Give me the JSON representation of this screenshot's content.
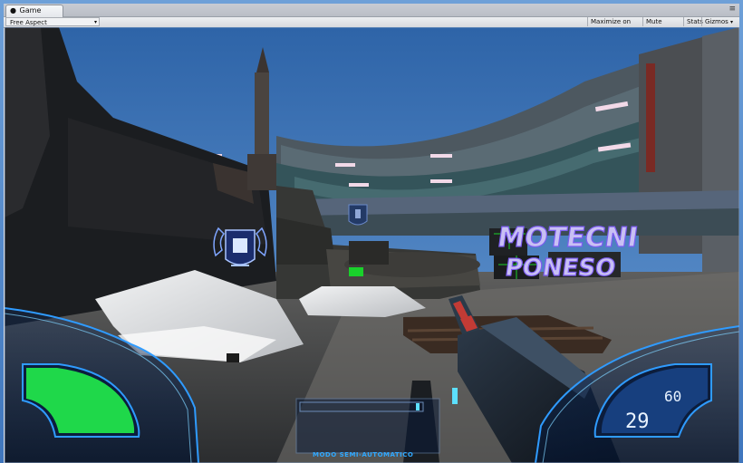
{
  "window": {
    "tab_label": "Game",
    "tab_icon": "unity-game-icon",
    "menu_icon": "tab-menu-icon"
  },
  "toolbar": {
    "aspect_label": "Free Aspect",
    "maximize_label": "Maximize on Play",
    "mute_label": "Mute audio",
    "stats_label": "Stats",
    "gizmos_label": "Gizmos"
  },
  "game": {
    "wall_sign": "MOTECNI",
    "wall_sign_lower": "PONESO",
    "ammo_current": "29",
    "ammo_reserve": "60",
    "fire_mode": "MODO SEMI-AUTOMATICO",
    "health_level": 1.0,
    "colors": {
      "hud_blue": "#2f9bff",
      "health_green": "#1fd84a",
      "marker_green": "#19d12b"
    }
  }
}
